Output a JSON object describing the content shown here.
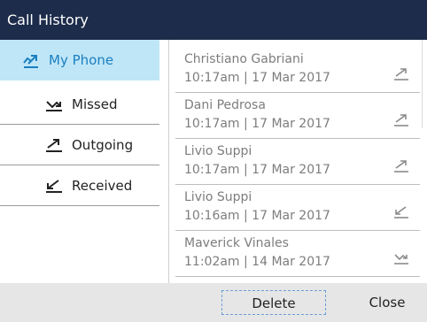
{
  "window": {
    "title": "Call History"
  },
  "sidebar": {
    "items": [
      {
        "label": "My Phone",
        "icon": "all-calls-icon",
        "selected": true
      },
      {
        "label": "Missed",
        "icon": "missed-call-icon"
      },
      {
        "label": "Outgoing",
        "icon": "outgoing-call-icon"
      },
      {
        "label": "Received",
        "icon": "received-call-icon"
      }
    ]
  },
  "calls": [
    {
      "name": "Christiano Gabriani",
      "time": "10:17am | 17 Mar 2017",
      "type_icon": "outgoing-call-icon"
    },
    {
      "name": "Dani Pedrosa",
      "time": "10:17am | 17 Mar 2017",
      "type_icon": "outgoing-call-icon"
    },
    {
      "name": "Livio Suppi",
      "time": "10:17am | 17 Mar 2017",
      "type_icon": "outgoing-call-icon"
    },
    {
      "name": "Livio Suppi",
      "time": "10:16am | 17 Mar 2017",
      "type_icon": "received-call-icon"
    },
    {
      "name": "Maverick Vinales",
      "time": "11:02am | 14 Mar 2017",
      "type_icon": "missed-call-icon"
    }
  ],
  "softkeys": {
    "delete": "Delete",
    "close": "Close"
  },
  "colors": {
    "titlebar": "#1d2c4a",
    "selected_bg": "#bfe6f7",
    "selected_text": "#1a7fc0",
    "softkey_bar": "#e6e6e6"
  }
}
